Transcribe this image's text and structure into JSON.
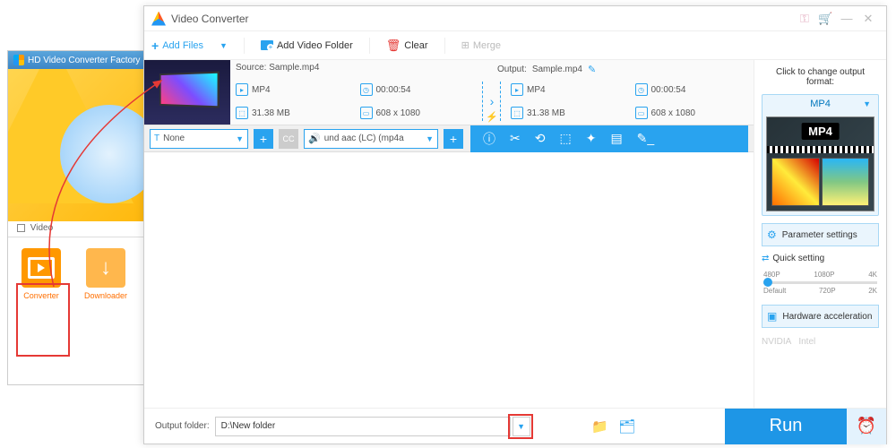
{
  "bg": {
    "title": "HD Video Converter Factory Pro",
    "tabs_label": "Video",
    "tool_converter": "Converter",
    "tool_downloader": "Downloader"
  },
  "win": {
    "title": "Video Converter"
  },
  "toolbar": {
    "add_files": "Add Files",
    "add_folder": "Add Video Folder",
    "clear": "Clear",
    "merge": "Merge"
  },
  "item": {
    "source_label": "Source:",
    "source_file": "Sample.mp4",
    "output_label": "Output:",
    "output_file": "Sample.mp4",
    "src_format": "MP4",
    "src_duration": "00:00:54",
    "src_size": "31.38 MB",
    "src_res": "608 x 1080",
    "out_format": "MP4",
    "out_duration": "00:00:54",
    "out_size": "31.38 MB",
    "out_res": "608 x 1080"
  },
  "editbar": {
    "subtitle": "None",
    "audio": "und aac (LC) (mp4a"
  },
  "side": {
    "change_format": "Click to change output format:",
    "format": "MP4",
    "badge": "MP4",
    "parameter": "Parameter settings",
    "quick": "Quick setting",
    "ticks_top": [
      "480P",
      "1080P",
      "4K"
    ],
    "ticks_bot": [
      "Default",
      "720P",
      "2K"
    ],
    "hw": "Hardware acceleration",
    "nvidia": "NVIDIA",
    "intel": "Intel"
  },
  "footer": {
    "label": "Output folder:",
    "path": "D:\\New folder",
    "run": "Run"
  }
}
